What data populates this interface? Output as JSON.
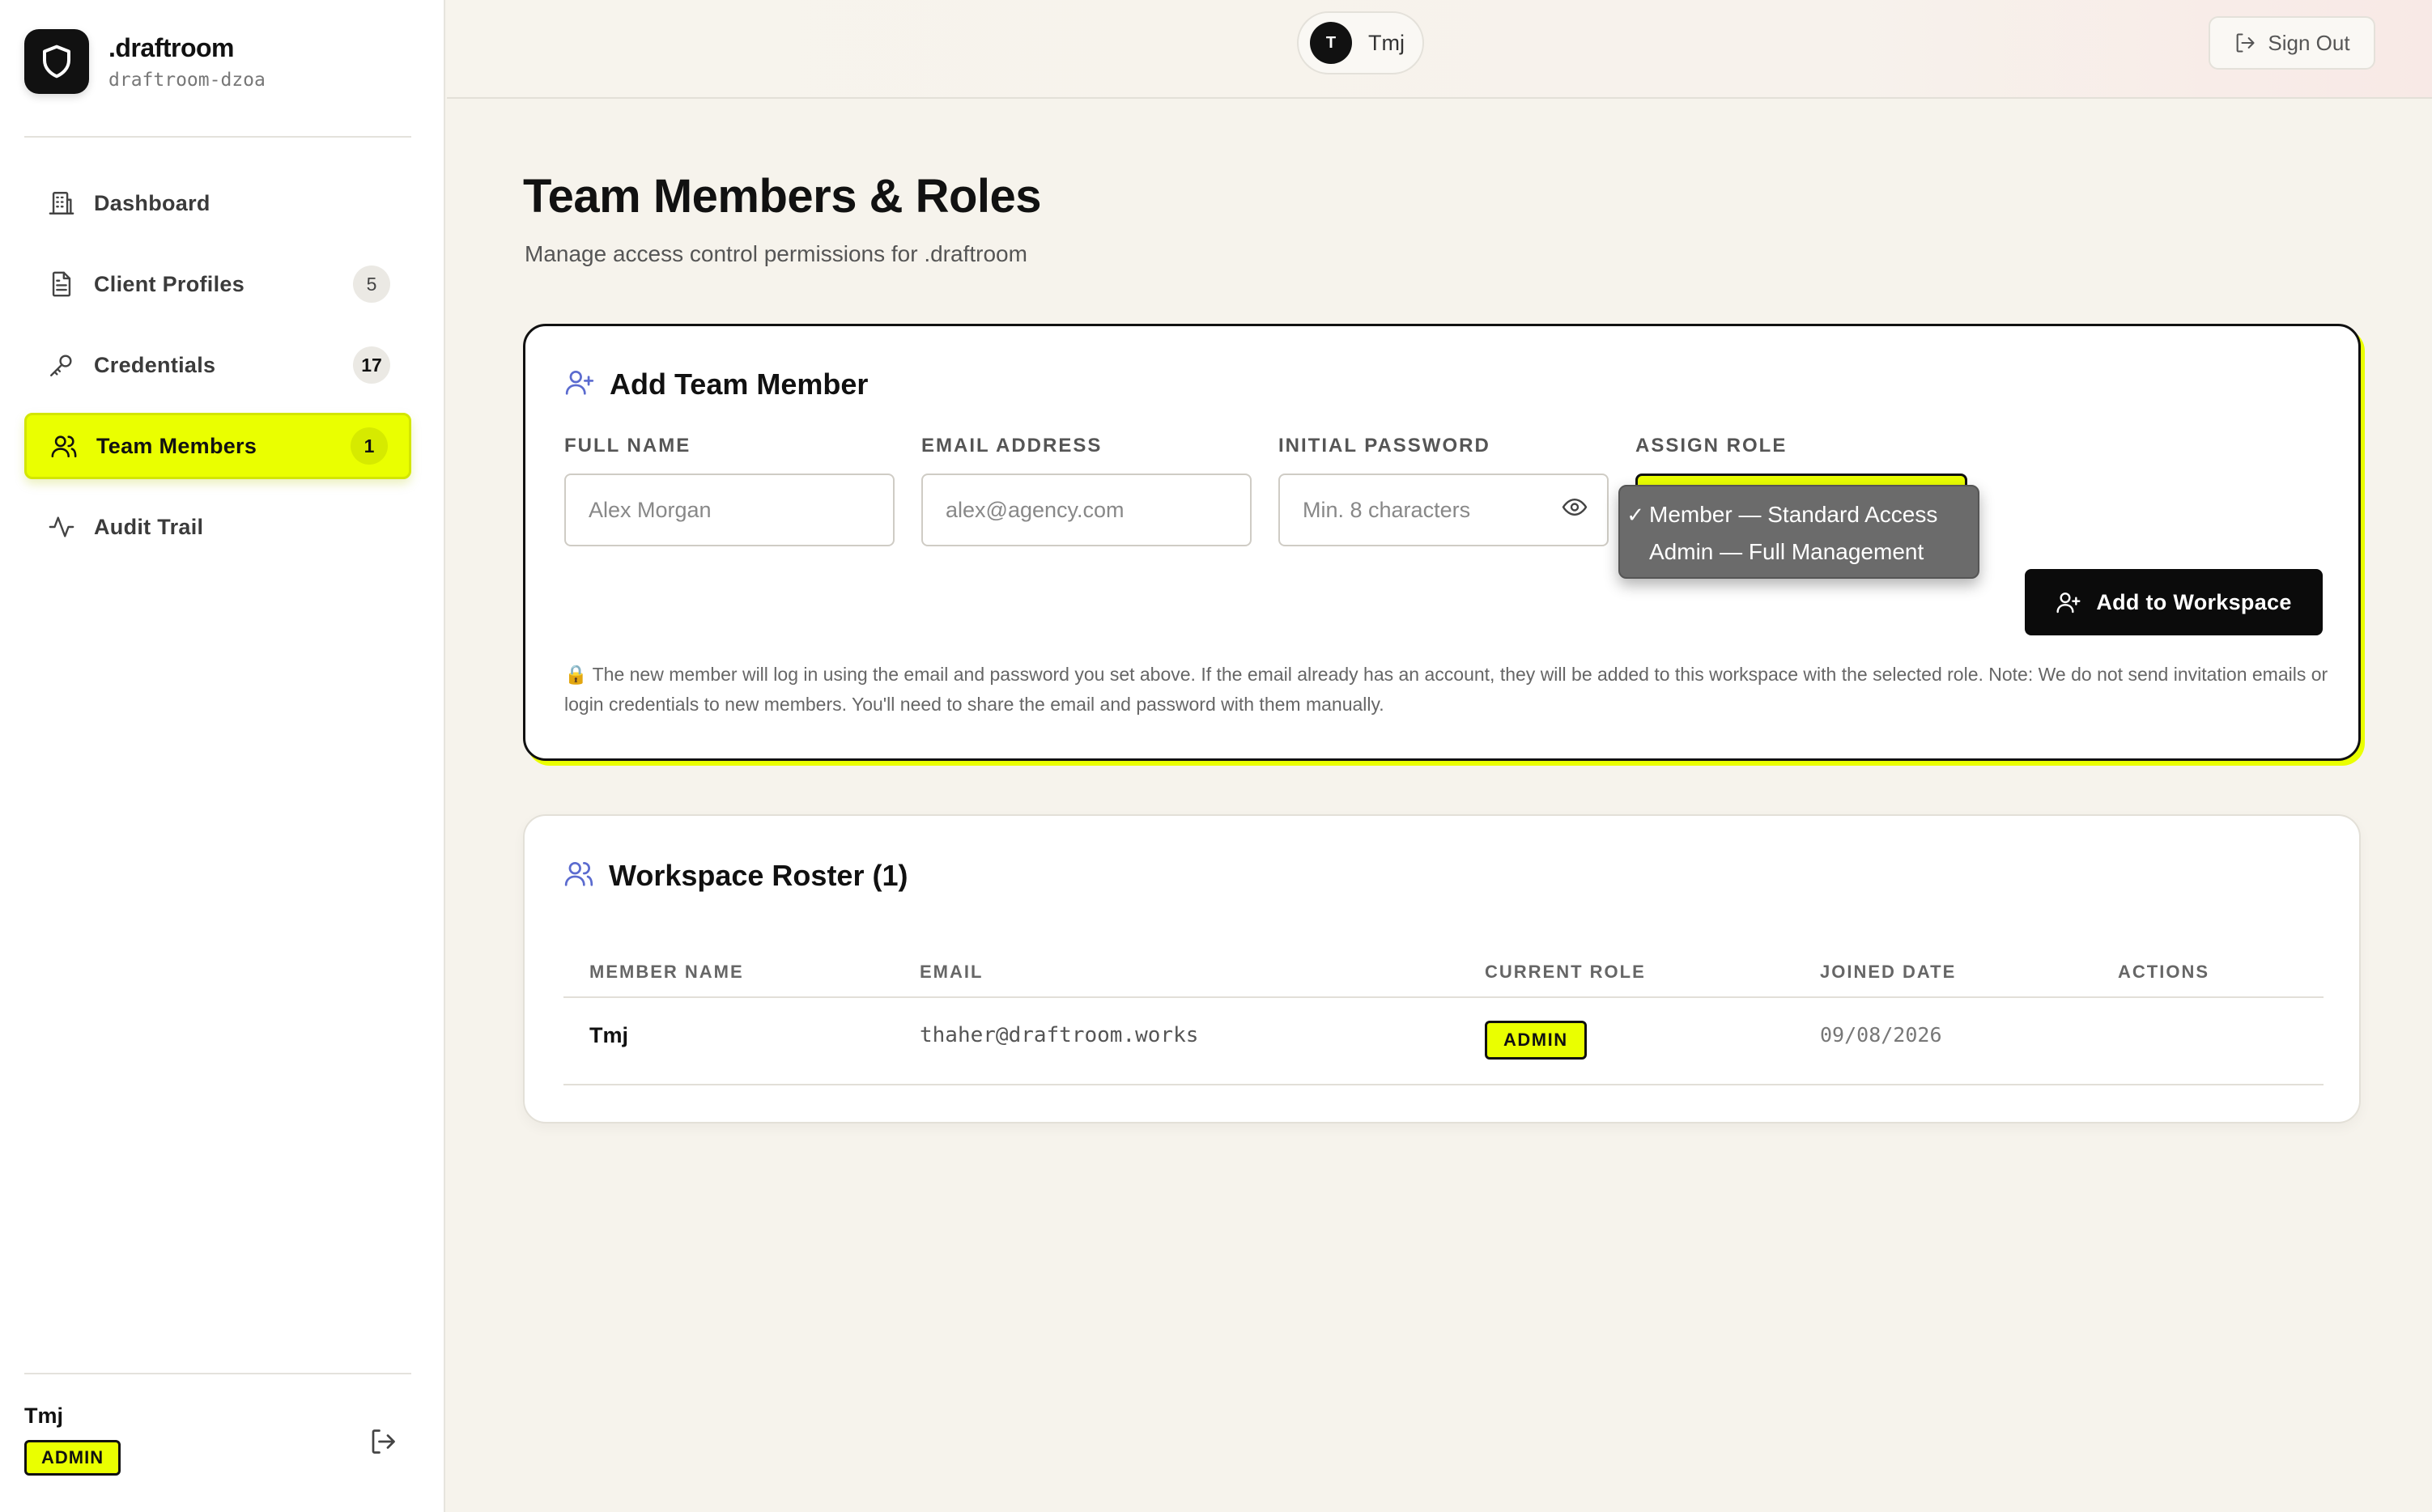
{
  "colors": {
    "accent": "#eaff00",
    "dark": "#111111",
    "icon_blue": "#5b6bcf"
  },
  "brand": {
    "name": ".draftroom",
    "slug": "draftroom-dzoa",
    "icon": "shield-icon"
  },
  "sidebar": {
    "items": [
      {
        "label": "Dashboard",
        "icon": "building-icon",
        "badge": ""
      },
      {
        "label": "Client Profiles",
        "icon": "document-icon",
        "badge": "5"
      },
      {
        "label": "Credentials",
        "icon": "key-icon",
        "badge": "17"
      },
      {
        "label": "Team Members",
        "icon": "users-icon",
        "badge": "1",
        "active": true
      },
      {
        "label": "Audit Trail",
        "icon": "activity-icon",
        "badge": ""
      }
    ],
    "user": {
      "name": "Tmj",
      "role": "ADMIN"
    }
  },
  "topbar": {
    "avatar_initial": "T",
    "user_name": "Tmj",
    "sign_out": "Sign Out"
  },
  "page": {
    "title": "Team Members & Roles",
    "subtitle": "Manage access control permissions for .draftroom"
  },
  "add_member": {
    "title": "Add Team Member",
    "full_name": {
      "label": "FULL NAME",
      "placeholder": "Alex Morgan"
    },
    "email": {
      "label": "EMAIL ADDRESS",
      "placeholder": "alex@agency.com"
    },
    "password": {
      "label": "INITIAL PASSWORD",
      "placeholder": "Min. 8 characters"
    },
    "role": {
      "label": "ASSIGN ROLE",
      "options": [
        {
          "label": "Member — Standard Access",
          "selected": true
        },
        {
          "label": "Admin — Full Management",
          "selected": false
        }
      ]
    },
    "submit": "Add to Workspace",
    "note": "🔒 The new member will log in using the email and password you set above. If the email already has an account, they will be added to this workspace with the selected role. Note: We do not send invitation emails or login credentials to new members. You'll need to share the email and password with them manually."
  },
  "roster": {
    "title": "Workspace Roster (1)",
    "columns": [
      "MEMBER NAME",
      "EMAIL",
      "CURRENT ROLE",
      "JOINED DATE",
      "ACTIONS"
    ],
    "rows": [
      {
        "name": "Tmj",
        "email": "thaher@draftroom.works",
        "role": "ADMIN",
        "joined": "09/08/2026",
        "actions": ""
      }
    ]
  }
}
